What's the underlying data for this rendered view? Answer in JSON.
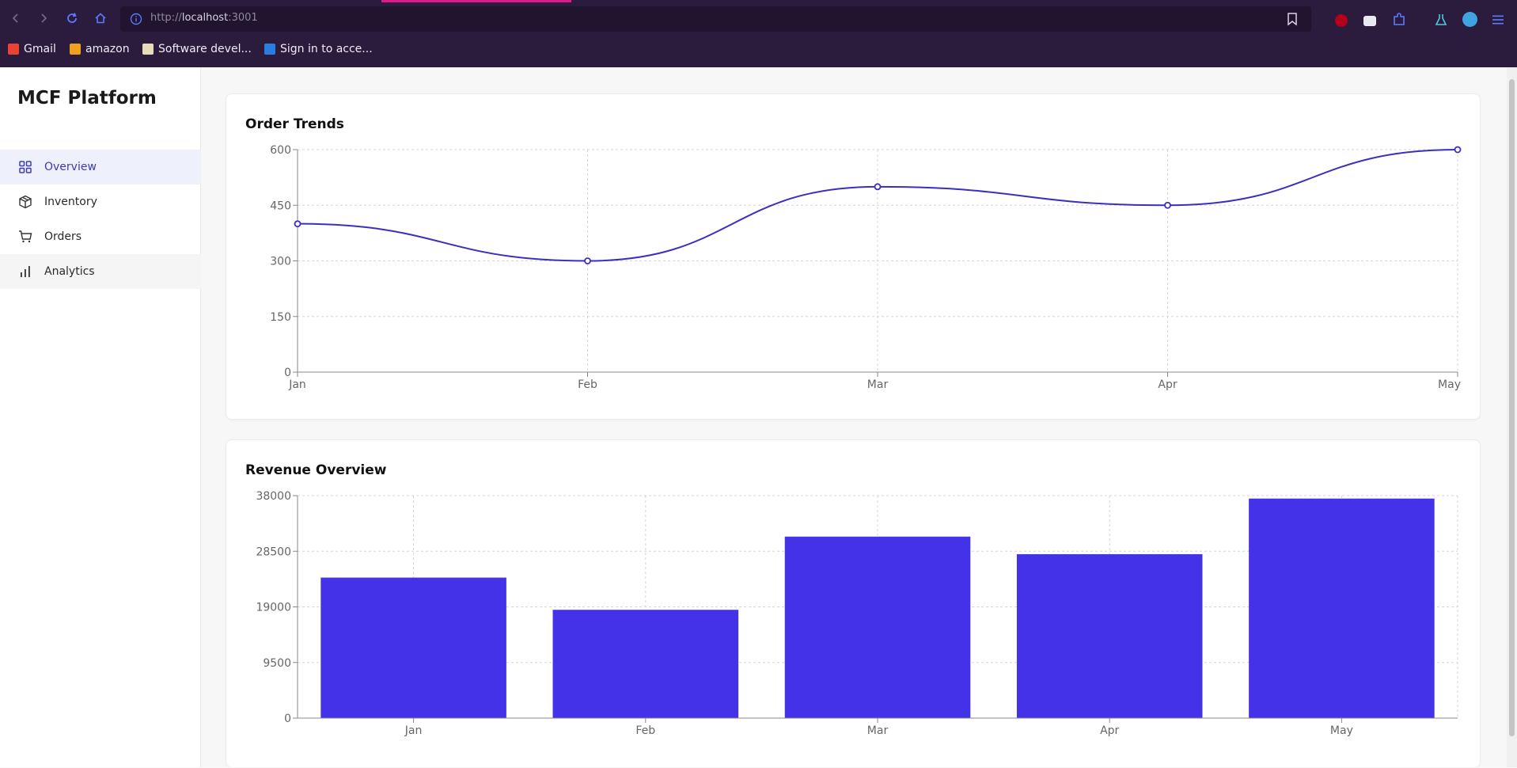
{
  "browser": {
    "url_prefix": "http://",
    "url_host": "localhost",
    "url_suffix": ":3001",
    "bookmarks": [
      {
        "label": "Gmail",
        "icon": "gmail-icon",
        "color": "#ea4335"
      },
      {
        "label": "amazon",
        "icon": "amazon-icon",
        "color": "#f0a020"
      },
      {
        "label": "Software devel...",
        "icon": "software-icon",
        "color": "#e8dcb8"
      },
      {
        "label": "Sign in to acce...",
        "icon": "signin-icon",
        "color": "#2a7de1"
      }
    ]
  },
  "sidebar": {
    "brand": "MCF Platform",
    "items": [
      {
        "label": "Overview",
        "icon": "grid-icon",
        "active": true
      },
      {
        "label": "Inventory",
        "icon": "box-icon",
        "active": false
      },
      {
        "label": "Orders",
        "icon": "cart-icon",
        "active": false
      },
      {
        "label": "Analytics",
        "icon": "bar-chart-icon",
        "active": false
      }
    ]
  },
  "cards": {
    "orders_title": "Order Trends",
    "revenue_title": "Revenue Overview"
  },
  "colors": {
    "accent": "#4432e8",
    "line": "#3b2fc0"
  },
  "chart_data": [
    {
      "type": "line",
      "title": "Order Trends",
      "categories": [
        "Jan",
        "Feb",
        "Mar",
        "Apr",
        "May"
      ],
      "values": [
        400,
        300,
        500,
        450,
        600
      ],
      "yticks": [
        0,
        150,
        300,
        450,
        600
      ],
      "ylim": [
        0,
        600
      ],
      "grid": true
    },
    {
      "type": "bar",
      "title": "Revenue Overview",
      "categories": [
        "Jan",
        "Feb",
        "Mar",
        "Apr",
        "May"
      ],
      "values": [
        24000,
        18500,
        31000,
        28000,
        37500
      ],
      "yticks": [
        0,
        9500,
        19000,
        28500,
        38000
      ],
      "ylim": [
        0,
        38000
      ],
      "grid": true
    }
  ]
}
